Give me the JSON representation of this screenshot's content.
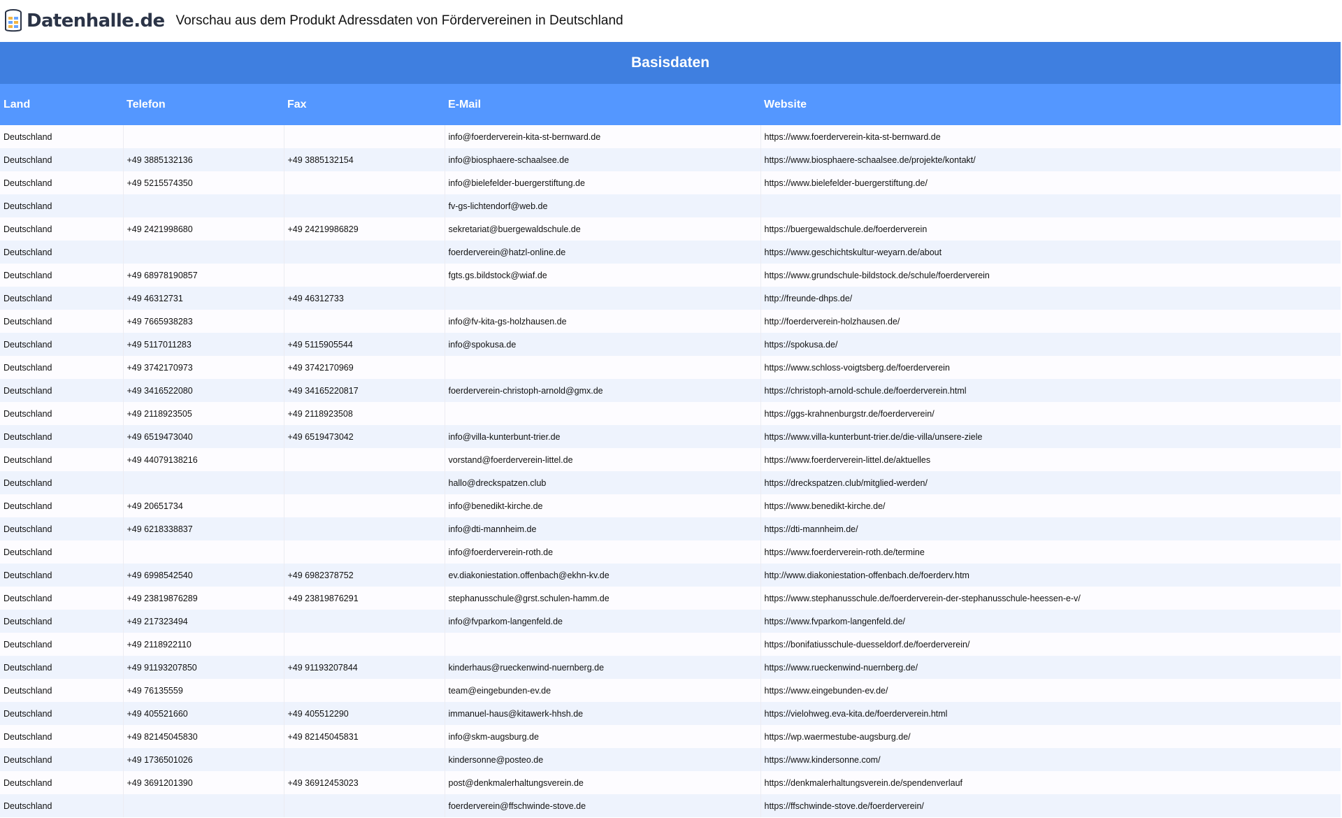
{
  "header": {
    "logo_text": "Datenhalle.de",
    "title": "Vorschau aus dem Produkt Adressdaten von Fördervereinen in Deutschland"
  },
  "table": {
    "group_header": "Basisdaten",
    "columns": [
      "Land",
      "Telefon",
      "Fax",
      "E-Mail",
      "Website"
    ],
    "rows": [
      [
        "Deutschland",
        "",
        "",
        "info@foerderverein-kita-st-bernward.de",
        "https://www.foerderverein-kita-st-bernward.de"
      ],
      [
        "Deutschland",
        "+49 3885132136",
        "+49 3885132154",
        "info@biosphaere-schaalsee.de",
        "https://www.biosphaere-schaalsee.de/projekte/kontakt/"
      ],
      [
        "Deutschland",
        "+49 5215574350",
        "",
        "info@bielefelder-buergerstiftung.de",
        "https://www.bielefelder-buergerstiftung.de/"
      ],
      [
        "Deutschland",
        "",
        "",
        "fv-gs-lichtendorf@web.de",
        ""
      ],
      [
        "Deutschland",
        "+49 2421998680",
        "+49 24219986829",
        "sekretariat@buergewaldschule.de",
        "https://buergewaldschule.de/foerderverein"
      ],
      [
        "Deutschland",
        "",
        "",
        "foerderverein@hatzl-online.de",
        "https://www.geschichtskultur-weyarn.de/about"
      ],
      [
        "Deutschland",
        "+49 68978190857",
        "",
        "fgts.gs.bildstock@wiaf.de",
        "https://www.grundschule-bildstock.de/schule/foerderverein"
      ],
      [
        "Deutschland",
        "+49 46312731",
        "+49 46312733",
        "",
        "http://freunde-dhps.de/"
      ],
      [
        "Deutschland",
        "+49 7665938283",
        "",
        "info@fv-kita-gs-holzhausen.de",
        "http://foerderverein-holzhausen.de/"
      ],
      [
        "Deutschland",
        "+49 5117011283",
        "+49 5115905544",
        "info@spokusa.de",
        "https://spokusa.de/"
      ],
      [
        "Deutschland",
        "+49 3742170973",
        "+49 3742170969",
        "",
        "https://www.schloss-voigtsberg.de/foerderverein"
      ],
      [
        "Deutschland",
        "+49 3416522080",
        "+49 34165220817",
        "foerderverein-christoph-arnold@gmx.de",
        "https://christoph-arnold-schule.de/foerderverein.html"
      ],
      [
        "Deutschland",
        "+49 2118923505",
        "+49 2118923508",
        "",
        "https://ggs-krahnenburgstr.de/foerderverein/"
      ],
      [
        "Deutschland",
        "+49 6519473040",
        "+49 6519473042",
        "info@villa-kunterbunt-trier.de",
        "https://www.villa-kunterbunt-trier.de/die-villa/unsere-ziele"
      ],
      [
        "Deutschland",
        "+49 44079138216",
        "",
        "vorstand@foerderverein-littel.de",
        "https://www.foerderverein-littel.de/aktuelles"
      ],
      [
        "Deutschland",
        "",
        "",
        "hallo@dreckspatzen.club",
        "https://dreckspatzen.club/mitglied-werden/"
      ],
      [
        "Deutschland",
        "+49 20651734",
        "",
        "info@benedikt-kirche.de",
        "https://www.benedikt-kirche.de/"
      ],
      [
        "Deutschland",
        "+49 6218338837",
        "",
        "info@dti-mannheim.de",
        "https://dti-mannheim.de/"
      ],
      [
        "Deutschland",
        "",
        "",
        "info@foerderverein-roth.de",
        "https://www.foerderverein-roth.de/termine"
      ],
      [
        "Deutschland",
        "+49 6998542540",
        "+49 6982378752",
        "ev.diakoniestation.offenbach@ekhn-kv.de",
        "http://www.diakoniestation-offenbach.de/foerderv.htm"
      ],
      [
        "Deutschland",
        "+49 23819876289",
        "+49 23819876291",
        "stephanusschule@grst.schulen-hamm.de",
        "https://www.stephanusschule.de/foerderverein-der-stephanusschule-heessen-e-v/"
      ],
      [
        "Deutschland",
        "+49 217323494",
        "",
        "info@fvparkom-langenfeld.de",
        "https://www.fvparkom-langenfeld.de/"
      ],
      [
        "Deutschland",
        "+49 2118922110",
        "",
        "",
        "https://bonifatiusschule-duesseldorf.de/foerderverein/"
      ],
      [
        "Deutschland",
        "+49 91193207850",
        "+49 91193207844",
        "kinderhaus@rueckenwind-nuernberg.de",
        "https://www.rueckenwind-nuernberg.de/"
      ],
      [
        "Deutschland",
        "+49 76135559",
        "",
        "team@eingebunden-ev.de",
        "https://www.eingebunden-ev.de/"
      ],
      [
        "Deutschland",
        "+49 405521660",
        "+49 405512290",
        "immanuel-haus@kitawerk-hhsh.de",
        "https://vielohweg.eva-kita.de/foerderverein.html"
      ],
      [
        "Deutschland",
        "+49 82145045830",
        "+49 82145045831",
        "info@skm-augsburg.de",
        "https://wp.waermestube-augsburg.de/"
      ],
      [
        "Deutschland",
        "+49 1736501026",
        "",
        "kindersonne@posteo.de",
        "https://www.kindersonne.com/"
      ],
      [
        "Deutschland",
        "+49 3691201390",
        "+49 36912453023",
        "post@denkmalerhaltungsverein.de",
        "https://denkmalerhaltungsverein.de/spendenverlauf"
      ],
      [
        "Deutschland",
        "",
        "",
        "foerderverein@ffschwinde-stove.de",
        "https://ffschwinde-stove.de/foerderverein/"
      ]
    ]
  }
}
